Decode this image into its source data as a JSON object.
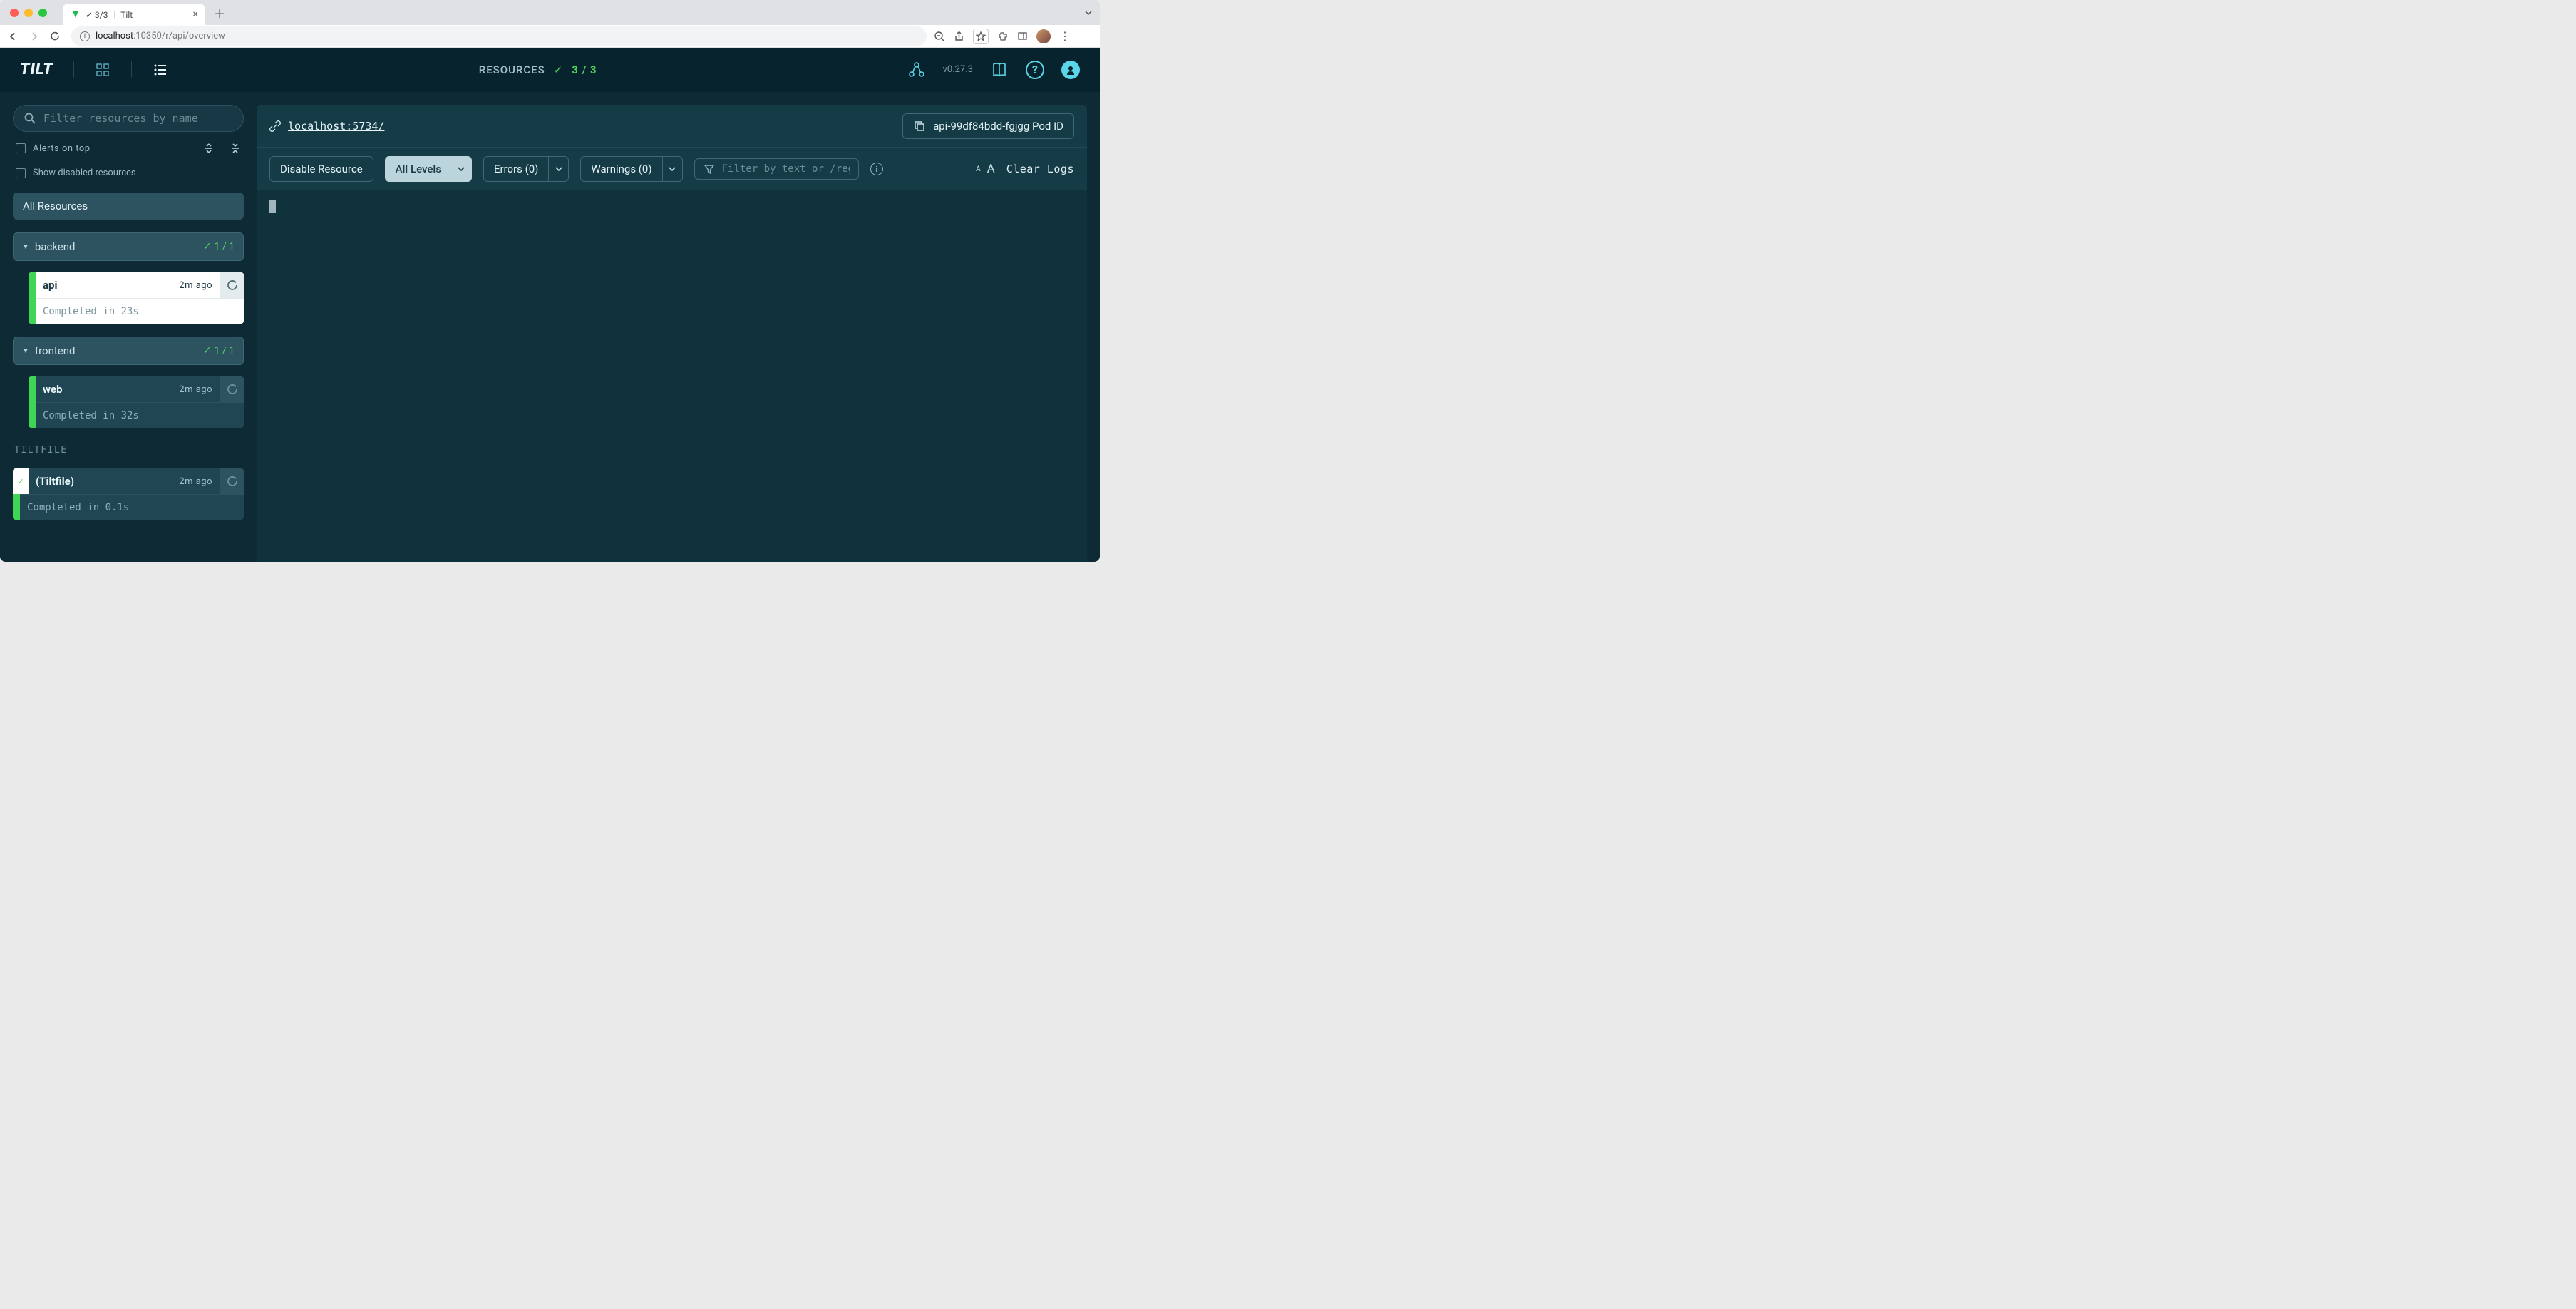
{
  "browser": {
    "tab": {
      "prefix": "✓ 3/3",
      "sep": "｜",
      "title": "Tilt"
    },
    "url_host": "localhost",
    "url_port_path": ":10350/r/api/overview"
  },
  "header": {
    "resources_label": "RESOURCES",
    "resources_count": "3 / 3",
    "version": "v0.27.3"
  },
  "sidebar": {
    "search_placeholder": "Filter resources by name",
    "alerts_on_top": "Alerts on top",
    "show_disabled": "Show disabled resources",
    "all_resources": "All Resources",
    "tiltfile_section": "TILTFILE",
    "groups": [
      {
        "name": "backend",
        "count": "1 / 1",
        "items": [
          {
            "name": "api",
            "time": "2m ago",
            "status": "Completed in 23s",
            "selected": true
          }
        ]
      },
      {
        "name": "frontend",
        "count": "1 / 1",
        "items": [
          {
            "name": "web",
            "time": "2m ago",
            "status": "Completed in 32s",
            "selected": false
          }
        ]
      }
    ],
    "tiltfile": {
      "name": "(Tiltfile)",
      "time": "2m ago",
      "status": "Completed in 0.1s"
    }
  },
  "main": {
    "endpoint": "localhost:5734/",
    "pod_id": "api-99df84bdd-fgjgg Pod ID",
    "disable_btn": "Disable Resource",
    "level_btn": "All Levels",
    "errors_btn": "Errors (0)",
    "warnings_btn": "Warnings (0)",
    "filter_placeholder": "Filter by text or /regexp/",
    "font_small": "A",
    "font_large": "A",
    "clear_logs": "Clear Logs"
  }
}
